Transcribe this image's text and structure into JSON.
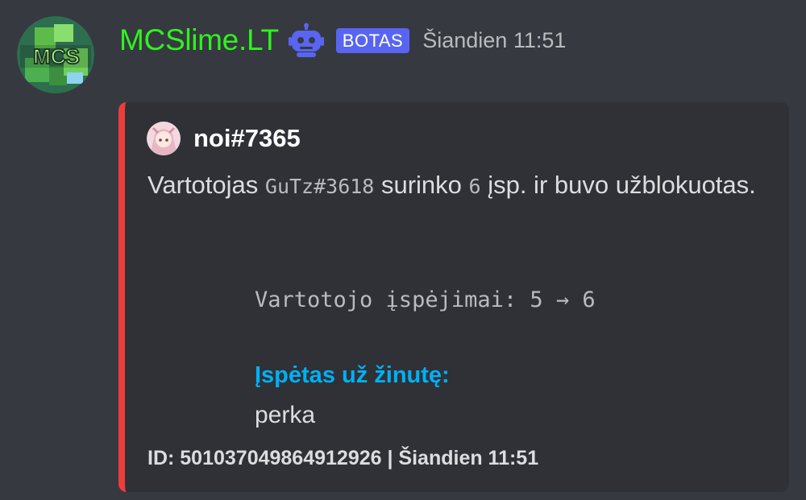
{
  "message": {
    "author": {
      "name": "MCSlime.LT",
      "name_color": "#2ff21f",
      "avatar_icon": "mcslime-logo-icon",
      "avatar_text": "MCS",
      "bot_icon": "robot-icon",
      "badge": "BOTAS"
    },
    "timestamp": "Šiandien 11:51"
  },
  "embed": {
    "accent_color": "#ec3d3d",
    "author": {
      "name": "noi#7365",
      "avatar_icon": "anime-avatar-icon"
    },
    "description": {
      "prefix": "Vartotojas ",
      "user_code": "GuTz#3618",
      "middle": " surinko ",
      "count_code": "6",
      "suffix": " įsp. ir buvo užblokuotas."
    },
    "warnings_line": "Vartotojo įspėjimai: 5 → 6",
    "field": {
      "name": "Įspėtas už žinutę:",
      "name_color": "#00b0f4",
      "value": "perka"
    },
    "footer": "ID: 501037049864912926 | Šiandien 11:51"
  }
}
